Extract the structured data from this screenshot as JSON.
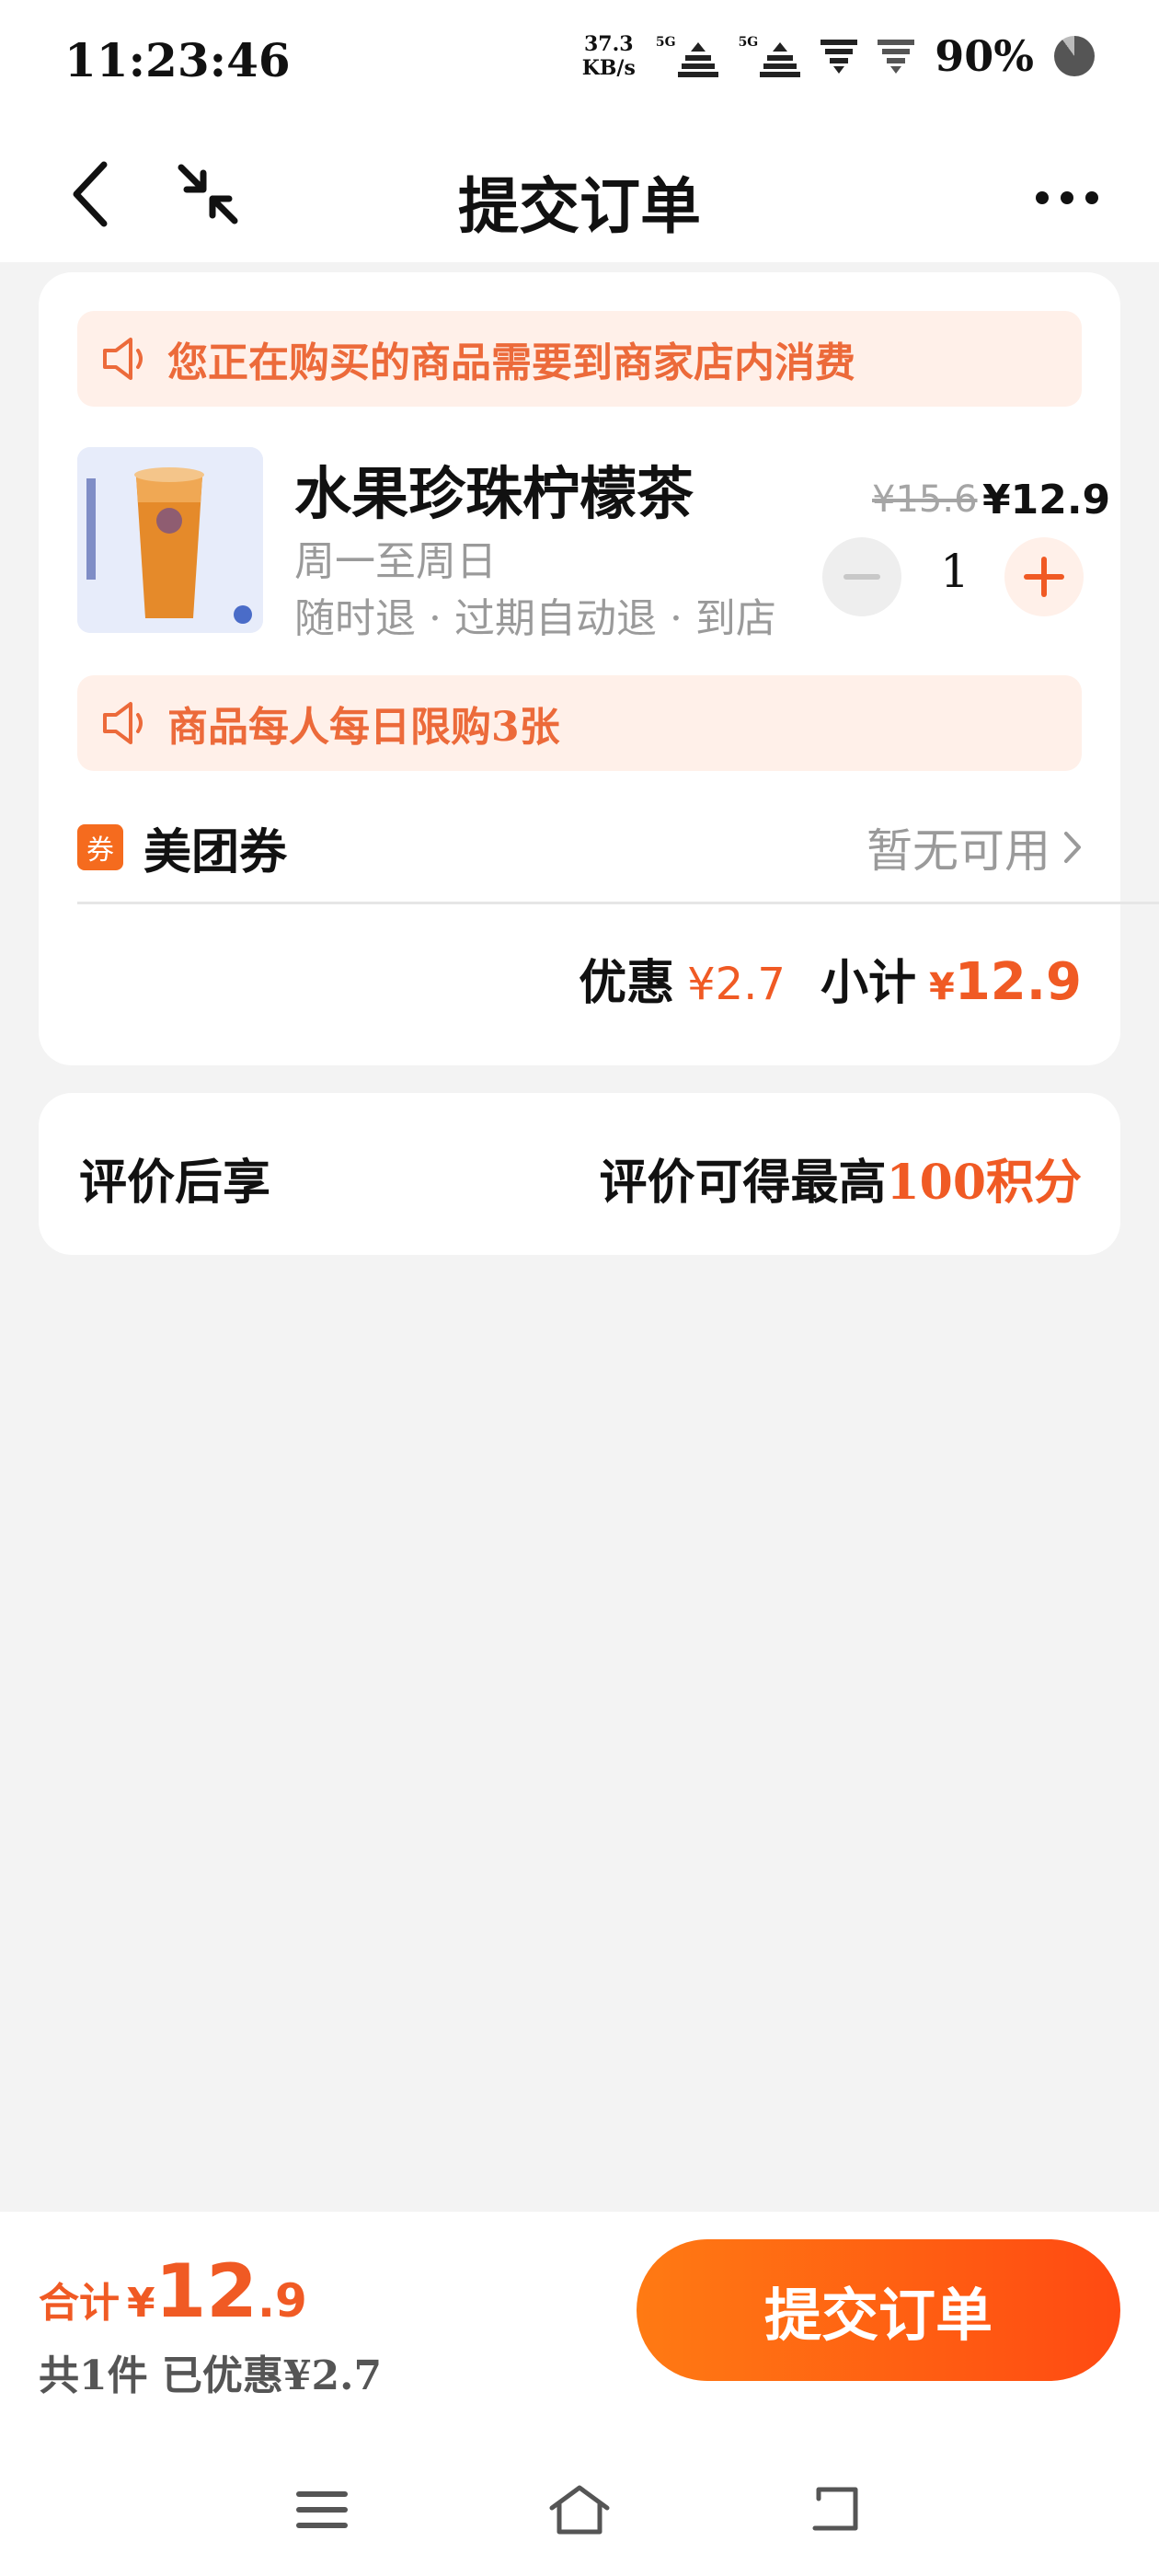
{
  "status_bar": {
    "time": "11:23:46",
    "net_speed_value": "37.3",
    "net_speed_unit": "KB/s",
    "sim1_label": "5G",
    "sim2_label": "5G",
    "battery": "90%"
  },
  "nav": {
    "title": "提交订单"
  },
  "order": {
    "notice_top": "您正在购买的商品需要到商家店内消费",
    "product": {
      "name": "水果珍珠柠檬茶",
      "days": "周一至周日",
      "rules": "随时退 · 过期自动退 · 到店",
      "price_old": "¥15.6",
      "price_now": "¥12.9",
      "quantity": "1"
    },
    "notice_limit": "商品每人每日限购3张",
    "coupon": {
      "icon_text": "券",
      "label": "美团券",
      "value": "暂无可用"
    },
    "summary": {
      "discount_label": "优惠",
      "discount_value": "¥2.7",
      "subtotal_label": "小计",
      "subtotal_yen": "¥",
      "subtotal_value": "12.9"
    }
  },
  "review": {
    "left": "评价后享",
    "right_prefix": "评价可得最高",
    "right_highlight": "100积分"
  },
  "bottom": {
    "total_label": "合计",
    "total_yen": "¥",
    "total_int": "12",
    "total_dec": ".9",
    "sub_text": "共1件  已优惠¥2.7",
    "submit_label": "提交订单"
  },
  "colors": {
    "accent": "#f05a24",
    "notice_bg": "#fff0e9",
    "notice_text": "#ec6a3a",
    "button_gradient_start": "#ff7a13",
    "button_gradient_end": "#ff4a12"
  },
  "icons": {
    "back": "chevron-left-icon",
    "collapse": "collapse-arrows-icon",
    "more": "more-dots-icon",
    "notice": "speaker-icon",
    "minus": "minus-icon",
    "plus": "plus-icon",
    "coupon_arrow": "chevron-right-icon",
    "sys_menu": "menu-icon",
    "sys_home": "home-icon",
    "sys_back": "back-icon"
  }
}
